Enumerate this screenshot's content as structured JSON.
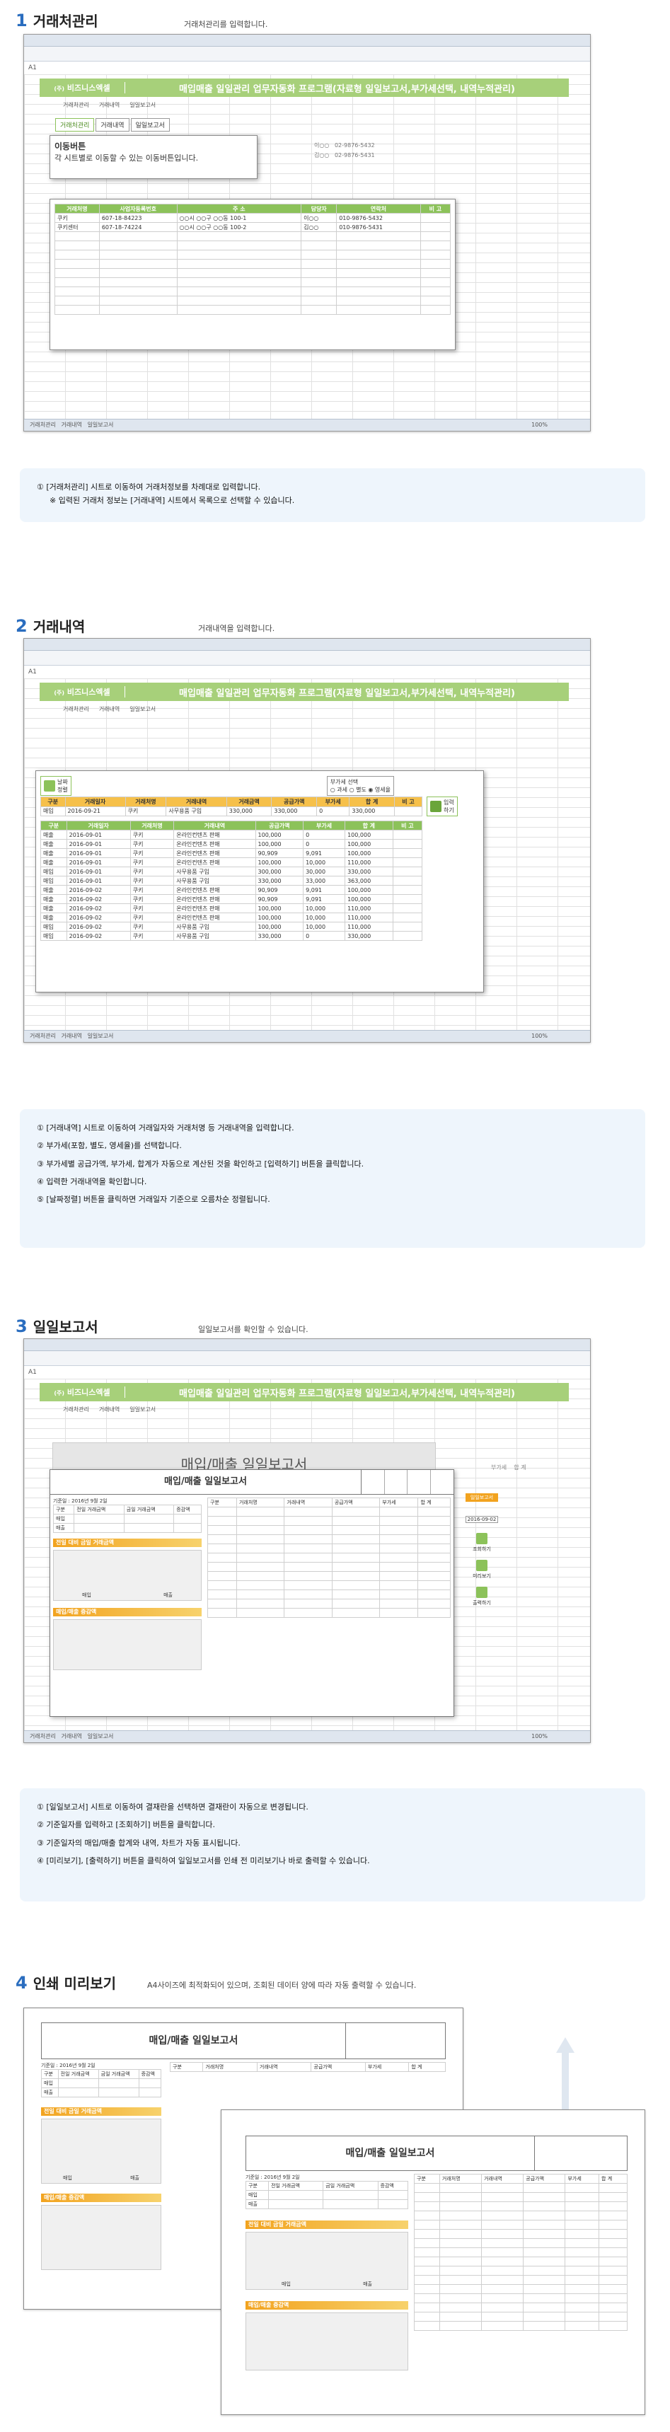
{
  "sections": [
    {
      "num": "1",
      "title": "거래처관리",
      "desc": "거래처관리를 입력합니다."
    },
    {
      "num": "2",
      "title": "거래내역",
      "desc": "거래내역을 입력합니다."
    },
    {
      "num": "3",
      "title": "일일보고서",
      "desc": "일일보고서를 확인할 수 있습니다."
    },
    {
      "num": "4",
      "title": "인쇄 미리보기",
      "desc": "A4사이즈에 최적화되어 있으며, 조회된 데이터 양에 따라 자동 출력할 수 있습니다."
    }
  ],
  "app": {
    "brand": "비즈니스엑셀",
    "brand_prefix": "(주)",
    "program_title": "매입매출 일일관리 업무자동화 프로그램(자료형 일일보고서,부가세선택, 내역누적관리)",
    "cell_ref": "A1",
    "sheet_nav": [
      "거래처관리",
      "거래내역",
      "일일보고서"
    ],
    "sheet_tabs": [
      "거래처관리",
      "거래내역",
      "일일보고서"
    ],
    "zoom": "100%"
  },
  "shot1": {
    "tabs": [
      "거래처관리",
      "거래내역",
      "일일보고서"
    ],
    "popup_title": "이동버튼",
    "popup_desc": "각 시트별로 이동할 수 있는 이동버튼입니다.",
    "headers": [
      "거래처명",
      "사업자등록번호",
      "주  소",
      "담당자",
      "연락처",
      "비  고"
    ],
    "rows": [
      [
        "쿠키",
        "607-18-84223",
        "○○시 ○○구 ○○동 100-1",
        "이○○",
        "010-9876-5432",
        ""
      ],
      [
        "쿠키센터",
        "607-18-74224",
        "○○시 ○○구 ○○동 100-2",
        "김○○",
        "010-9876-5431",
        ""
      ]
    ],
    "bg_contacts": [
      "02-9876-5432",
      "02-9876-5431"
    ],
    "bg_names": [
      "이○○",
      "김○○"
    ]
  },
  "note1": [
    "① [거래처관리] 시트로 이동하여 거래처정보를 차례대로 입력합니다.",
    "※ 입력된 거래처 정보는 [거래내역] 시트에서 목록으로 선택할 수 있습니다."
  ],
  "shot2": {
    "input_button": "입력\n하기",
    "sort_button": "날짜\n정렬",
    "tax_label": "부가세 선택",
    "tax_options": [
      "과세",
      "별도",
      "영세율"
    ],
    "input_headers": [
      "구분",
      "거래일자",
      "거래처명",
      "거래내역",
      "거래금액",
      "공급가액",
      "부가세",
      "합 계",
      "비 고"
    ],
    "input_row": [
      "매입",
      "2016-09-21",
      "쿠키",
      "사무용품 구입",
      "330,000",
      "330,000",
      "0",
      "330,000",
      ""
    ],
    "list_headers": [
      "구분",
      "거래일자",
      "거래처명",
      "거래내역",
      "공급가액",
      "부가세",
      "합 계",
      "비 고"
    ],
    "list_rows": [
      [
        "매출",
        "2016-09-01",
        "쿠키",
        "온라인컨텐츠 판매",
        "100,000",
        "0",
        "100,000",
        ""
      ],
      [
        "매출",
        "2016-09-01",
        "쿠키",
        "온라인컨텐츠 판매",
        "100,000",
        "0",
        "100,000",
        ""
      ],
      [
        "매출",
        "2016-09-01",
        "쿠키",
        "온라인컨텐츠 판매",
        "90,909",
        "9,091",
        "100,000",
        ""
      ],
      [
        "매출",
        "2016-09-01",
        "쿠키",
        "온라인컨텐츠 판매",
        "100,000",
        "10,000",
        "110,000",
        ""
      ],
      [
        "매입",
        "2016-09-01",
        "쿠키",
        "사무용품 구입",
        "300,000",
        "30,000",
        "330,000",
        ""
      ],
      [
        "매입",
        "2016-09-01",
        "쿠키",
        "사무용품 구입",
        "330,000",
        "33,000",
        "363,000",
        ""
      ],
      [
        "매출",
        "2016-09-02",
        "쿠키",
        "온라인컨텐츠 판매",
        "90,909",
        "9,091",
        "100,000",
        ""
      ],
      [
        "매출",
        "2016-09-02",
        "쿠키",
        "온라인컨텐츠 판매",
        "90,909",
        "9,091",
        "100,000",
        ""
      ],
      [
        "매출",
        "2016-09-02",
        "쿠키",
        "온라인컨텐츠 판매",
        "100,000",
        "10,000",
        "110,000",
        ""
      ],
      [
        "매출",
        "2016-09-02",
        "쿠키",
        "온라인컨텐츠 판매",
        "100,000",
        "10,000",
        "110,000",
        ""
      ],
      [
        "매입",
        "2016-09-02",
        "쿠키",
        "사무용품 구입",
        "100,000",
        "10,000",
        "110,000",
        ""
      ],
      [
        "매입",
        "2016-09-02",
        "쿠키",
        "사무용품 구입",
        "330,000",
        "0",
        "330,000",
        ""
      ]
    ]
  },
  "note2": [
    "① [거래내역] 시트로 이동하여 거래일자와 거래처명 등 거래내역을 입력합니다.",
    "② 부가세(포함, 별도, 영세율)를 선택합니다.",
    "③ 부가세별 공급가액, 부가세, 합계가 자동으로 계산된 것을 확인하고 [입력하기] 버튼을 클릭합니다.",
    "④ 입력한 거래내역을 확인합니다.",
    "⑤ [날짜정렬] 버튼을 클릭하면 거래일자 기준으로 오름차순 정렬됩니다."
  ],
  "shot3": {
    "overlay_title": "매입/매출 일일보고서",
    "report_title": "매입/매출 일일보고서",
    "date_line": "기준일 : 2016년 9월 2일",
    "summary_headers": [
      "구분",
      "전일 거래금액",
      "금일 거래금액",
      "증감액"
    ],
    "summary_rows": [
      "매입",
      "매출"
    ],
    "chart1_title": "전일 대비 금일 거래금액",
    "chart2_title": "매입/매출 증감액",
    "chart_cats": [
      "매입",
      "매출"
    ],
    "detail_headers": [
      "구분",
      "거래처명",
      "거래내역",
      "공급가액",
      "부가세",
      "합 계"
    ],
    "side_select": "일일보고서",
    "side_date": "2016-09-02",
    "side_buttons": [
      "조회하기",
      "미리보기",
      "출력하기"
    ],
    "bg_col": [
      "부가세",
      "합 계"
    ]
  },
  "note3": [
    "① [일일보고서] 시트로 이동하여 결재란을 선택하면 결재란이 자동으로 변경됩니다.",
    "② 기준일자를 입력하고 [조회하기] 버튼을 클릭합니다.",
    "③ 기준일자의 매입/매출 합계와 내역, 차트가 자동 표시됩니다.",
    "④ [미리보기], [출력하기] 버튼을 클릭하여 일일보고서를 인쇄 전 미리보기나 바로 출력할 수 있습니다."
  ],
  "print": {
    "report_title": "매입/매출 일일보고서",
    "date_line": "기준일 : 2016년 9월 2일",
    "summary_headers": [
      "구분",
      "전일 거래금액",
      "금일 거래금액",
      "증감액"
    ],
    "summary_rows": [
      "매입",
      "매출"
    ],
    "chart1_title": "전일 대비 금일 거래금액",
    "chart2_title": "매입/매출 증감액",
    "chart_cats": [
      "매입",
      "매출"
    ],
    "detail_headers": [
      "구분",
      "거래처명",
      "거래내역",
      "공급가액",
      "부가세",
      "합 계"
    ]
  },
  "colors": {
    "accent_blue": "#2a6dbf",
    "banner_green": "#a7d07a",
    "header_orange": "#f6c04a",
    "note_bg": "#eef5fc"
  }
}
